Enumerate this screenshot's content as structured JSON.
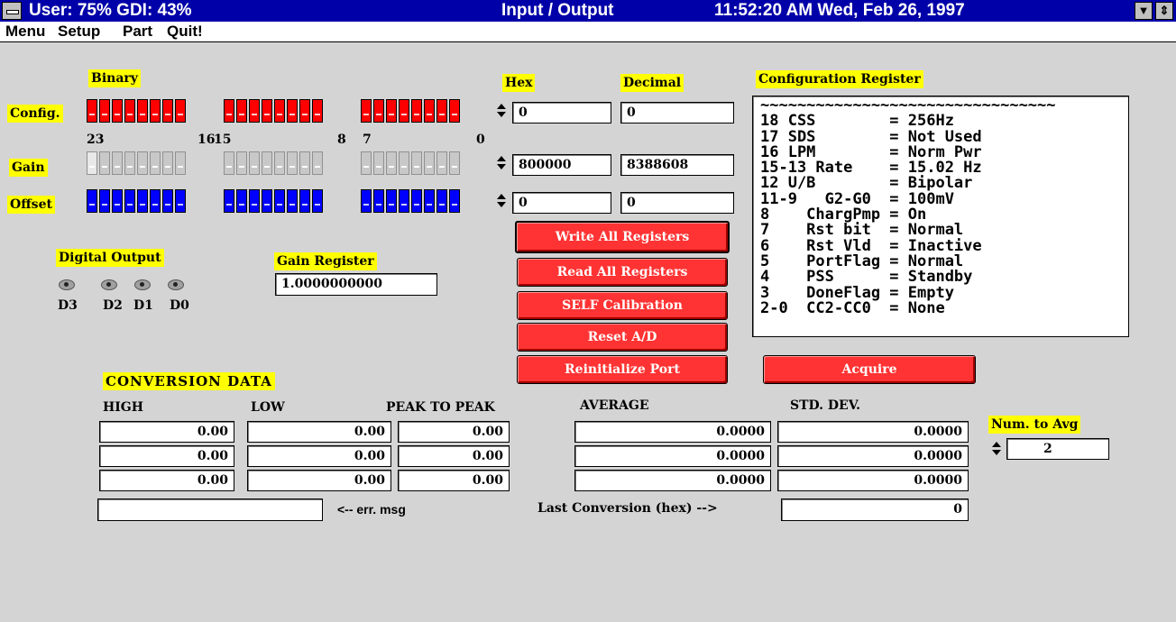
{
  "titlebar": {
    "resources": "User: 75%  GDI: 43%",
    "title": "Input / Output",
    "clock": "11:52:20 AM  Wed, Feb 26, 1997",
    "minimize_glyph": "▼",
    "restore_glyph": "⇕"
  },
  "menu": [
    "Menu",
    "Setup",
    "Part",
    "Quit!"
  ],
  "binary": {
    "label": "Binary",
    "hex_label": "Hex",
    "decimal_label": "Decimal",
    "config_label": "Config.",
    "gain_label": "Gain",
    "offset_label": "Offset",
    "bit_markers": {
      "b23": "23",
      "b16": "16",
      "b15": "15",
      "b8": "8",
      "b7": "7",
      "b0": "0"
    },
    "config": {
      "hex": "0",
      "decimal": "0",
      "bits": "000000000000000000000000"
    },
    "gain": {
      "hex": "800000",
      "decimal": "8388608",
      "bits": "100000000000000000000000"
    },
    "offset": {
      "hex": "0",
      "decimal": "0",
      "bits": "000000000000000000000000"
    }
  },
  "buttons": {
    "write_all": "Write All Registers",
    "read_all": "Read All Registers",
    "self_cal": "SELF Calibration",
    "reset_ad": "Reset A/D",
    "reinit_port": "Reinitialize Port",
    "acquire": "Acquire"
  },
  "digital_output": {
    "label": "Digital Output",
    "leds": [
      "D3",
      "D2",
      "D1",
      "D0"
    ]
  },
  "gain_register": {
    "label": "Gain Register",
    "value": "1.0000000000"
  },
  "config_register": {
    "label": "Configuration Register",
    "text": "~~~~~~~~~~~~~~~~~~~~~~~~~~~~~~~~\n18 CSS        = 256Hz\n17 SDS        = Not Used\n16 LPM        = Norm Pwr\n15-13 Rate    = 15.02 Hz\n12 U/B        = Bipolar\n11-9   G2-G0  = 100mV\n8    ChargPmp = On\n7    Rst bit  = Normal\n6    Rst Vld  = Inactive\n5    PortFlag = Normal\n4    PSS      = Standby\n3    DoneFlag = Empty\n2-0  CC2-CC0  = None"
  },
  "conversion": {
    "label": "CONVERSION DATA",
    "headers": {
      "high": "HIGH",
      "low": "LOW",
      "p2p": "PEAK TO PEAK",
      "avg": "AVERAGE",
      "std": "STD. DEV."
    },
    "rows": [
      {
        "high": "0.00",
        "low": "0.00",
        "p2p": "0.00",
        "avg": "0.0000",
        "std": "0.0000"
      },
      {
        "high": "0.00",
        "low": "0.00",
        "p2p": "0.00",
        "avg": "0.0000",
        "std": "0.0000"
      },
      {
        "high": "0.00",
        "low": "0.00",
        "p2p": "0.00",
        "avg": "0.0000",
        "std": "0.0000"
      }
    ],
    "err_msg_value": "",
    "err_msg_label": "<-- err. msg",
    "last_conv_label": "Last Conversion (hex) -->",
    "last_conv_value": "0",
    "num_avg_label": "Num. to Avg",
    "num_avg_value": "2"
  }
}
